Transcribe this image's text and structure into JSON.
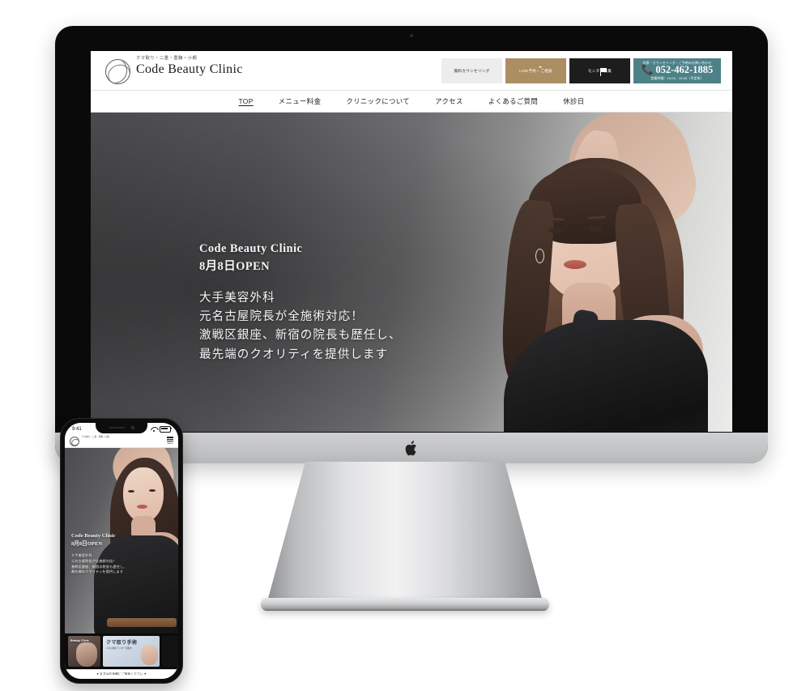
{
  "site": {
    "brand": {
      "tagline": "クマ取り・二重・豊胸・小顔",
      "name": "Code Beauty Clinic",
      "mark_icon": "leaf-circle-logo-icon"
    },
    "header_buttons": [
      {
        "label": "無料カウンセリング",
        "icon": "note-icon",
        "color": "#ededed"
      },
      {
        "label": "LINE予約・ご相談",
        "icon": "chat-bubble-icon",
        "color": "#ab8f63"
      },
      {
        "label": "モニター募集",
        "icon": "flag-icon",
        "color": "#1d1d1d"
      }
    ],
    "phone_box": {
      "top_text": "診察・カウンセリング・ご予約のお問い合わせ",
      "number": "052-462-1885",
      "hours": "営業時間：10:00 - 19:00（不定休）",
      "icon": "phone-handset-icon",
      "color": "#4d8188"
    },
    "nav": [
      {
        "label": "TOP",
        "active": true
      },
      {
        "label": "メニュー料金",
        "active": false
      },
      {
        "label": "クリニックについて",
        "active": false
      },
      {
        "label": "アクセス",
        "active": false
      },
      {
        "label": "よくあるご質問",
        "active": false
      },
      {
        "label": "休診日",
        "active": false
      }
    ],
    "hero": {
      "title": "Code Beauty Clinic",
      "open_date": "8月8日OPEN",
      "sub_lines": [
        "大手美容外科",
        "元名古屋院長が全施術対応！",
        "激戦区銀座、新宿の院長も歴任し、",
        "最先端のクオリティを提供します"
      ]
    }
  },
  "imac": {
    "logo_icon": "apple-logo-icon",
    "camera_icon": "webcam-dot-icon"
  },
  "phone": {
    "status": {
      "time": "9:41",
      "wifi_icon": "wifi-icon",
      "battery_icon": "battery-icon"
    },
    "header": {
      "tagline": "クマ取り・二重・豊胸・小顔",
      "name": "Code Beauty Clinic",
      "menu_icon": "hamburger-menu-icon",
      "menu_label": "MENU"
    },
    "hero": {
      "title": "Code Beauty Clinic",
      "open_date": "8月8日OPEN",
      "sub_lines": [
        "大手美容外科",
        "元名古屋院長が全施術対応！",
        "激戦区銀座、新宿の院長も歴任し、",
        "最先端のクオリティを提供します"
      ]
    },
    "cards": [
      {
        "title": "Beauty Clinic",
        "sub": ""
      },
      {
        "title": "クマ取り手術",
        "sub": "人気の施術\nモニター募集中"
      },
      {
        "title": "",
        "sub": ""
      }
    ],
    "bottom_bar": "♥ まずはお気軽にご相談ください ♥"
  }
}
